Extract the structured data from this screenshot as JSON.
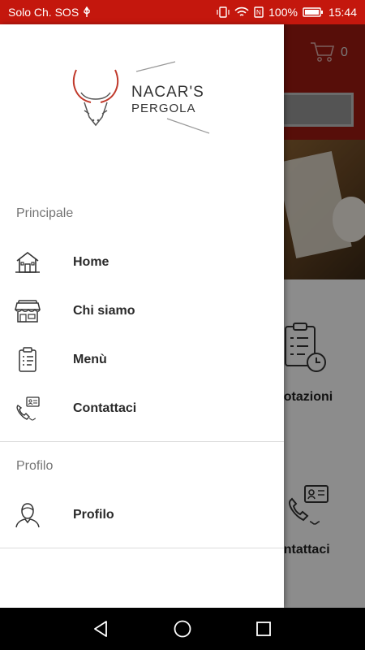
{
  "status_bar": {
    "carrier": "Solo Ch. SOS",
    "battery": "100%",
    "time": "15:44"
  },
  "background": {
    "cart_count": "0",
    "tile_1_label": "notazioni",
    "tile_2_label": "ontattaci"
  },
  "logo": {
    "line1": "NACAR'S",
    "line2": "PERGOLA"
  },
  "drawer": {
    "sections": [
      {
        "title": "Principale",
        "items": [
          {
            "label": "Home",
            "icon": "house-icon"
          },
          {
            "label": "Chi siamo",
            "icon": "shop-icon"
          },
          {
            "label": "Menù",
            "icon": "clipboard-menu-icon"
          },
          {
            "label": "Contattaci",
            "icon": "phone-contact-icon"
          }
        ]
      },
      {
        "title": "Profilo",
        "items": [
          {
            "label": "Profilo",
            "icon": "user-profile-icon"
          }
        ]
      }
    ]
  },
  "colors": {
    "status_bar": "#c4170d",
    "app_bar": "#9e1b12",
    "logo_red": "#c0392b",
    "text": "#2a2a2a",
    "section_title": "#757575"
  }
}
